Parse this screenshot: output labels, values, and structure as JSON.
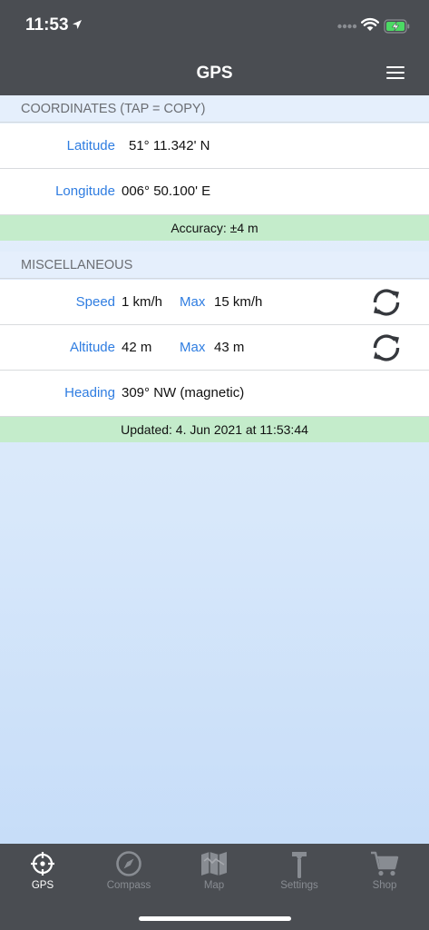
{
  "status_bar": {
    "time": "11:53"
  },
  "header": {
    "title": "GPS"
  },
  "coordinates": {
    "section_title": "COORDINATES (TAP = COPY)",
    "latitude_label": "Latitude",
    "latitude_value": "51° 11.342' N",
    "longitude_label": "Longitude",
    "longitude_value": "006° 50.100' E",
    "accuracy": "Accuracy: ±4 m"
  },
  "misc": {
    "section_title": "MISCELLANEOUS",
    "speed_label": "Speed",
    "speed_value": "1 km/h",
    "speed_max_label": "Max",
    "speed_max_value": "15 km/h",
    "altitude_label": "Altitude",
    "altitude_value": "42 m",
    "altitude_max_label": "Max",
    "altitude_max_value": "43 m",
    "heading_label": "Heading",
    "heading_value": "309° NW (magnetic)",
    "updated": "Updated: 4. Jun 2021 at 11:53:44"
  },
  "tabs": [
    {
      "label": "GPS",
      "icon": "crosshair-icon",
      "active": true
    },
    {
      "label": "Compass",
      "icon": "compass-icon",
      "active": false
    },
    {
      "label": "Map",
      "icon": "map-icon",
      "active": false
    },
    {
      "label": "Settings",
      "icon": "hammer-icon",
      "active": false
    },
    {
      "label": "Shop",
      "icon": "cart-icon",
      "active": false
    }
  ],
  "colors": {
    "header_bg": "#4a4d52",
    "label_blue": "#2f7de1",
    "info_bar_green": "#c4eccb",
    "section_bg": "#e5effc"
  }
}
